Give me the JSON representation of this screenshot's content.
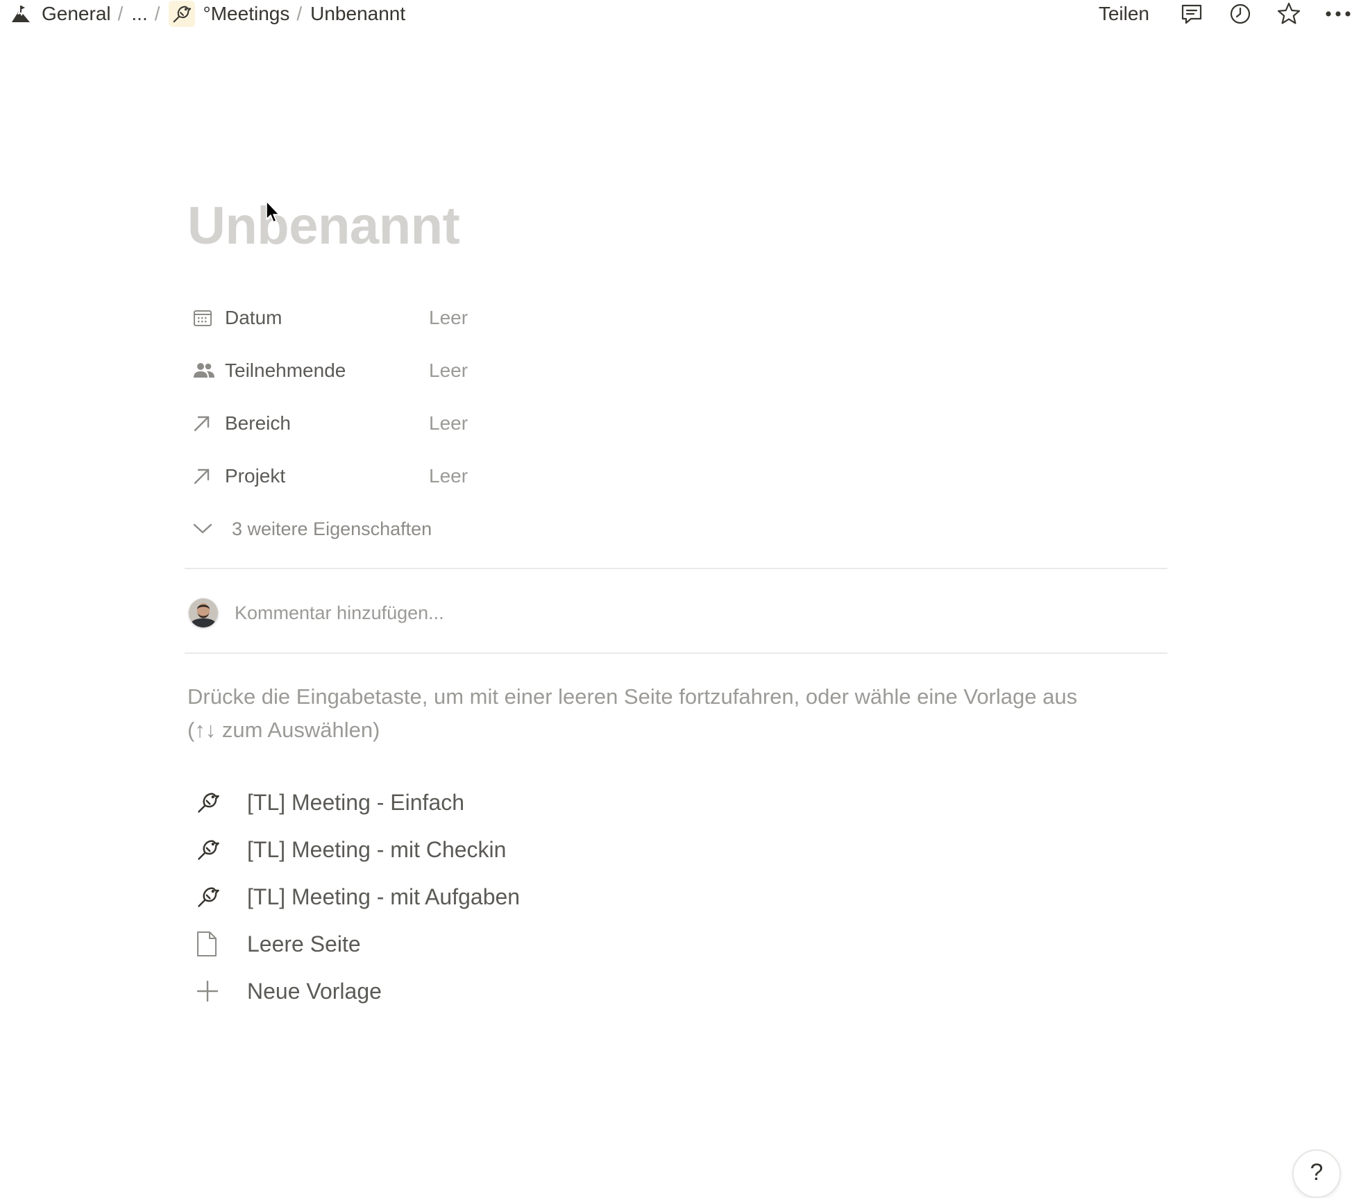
{
  "breadcrumb": {
    "items": [
      {
        "label": "General",
        "icon": "workspace-logo-icon"
      },
      {
        "label": "..."
      },
      {
        "label": "°Meetings",
        "icon": "bird-icon"
      },
      {
        "label": "Unbenannt"
      }
    ],
    "separator": "/"
  },
  "topbar": {
    "share_label": "Teilen",
    "icons": [
      "comment-icon",
      "clock-history-icon",
      "star-icon",
      "more-options-icon"
    ]
  },
  "page": {
    "title_placeholder": "Unbenannt"
  },
  "properties": [
    {
      "icon": "calendar-icon",
      "label": "Datum",
      "value": "Leer"
    },
    {
      "icon": "people-icon",
      "label": "Teilnehmende",
      "value": "Leer"
    },
    {
      "icon": "relation-arrow-icon",
      "label": "Bereich",
      "value": "Leer"
    },
    {
      "icon": "relation-arrow-icon",
      "label": "Projekt",
      "value": "Leer"
    }
  ],
  "more_properties_label": "3 weitere Eigenschaften",
  "comment": {
    "placeholder": "Kommentar hinzufügen..."
  },
  "template_hint": {
    "line1": "Drücke die Eingabetaste, um mit einer leeren Seite fortzufahren, oder wähle eine Vorlage aus",
    "line2": "(↑↓ zum Auswählen)"
  },
  "templates": [
    {
      "icon": "bird-icon",
      "label": "[TL] Meeting - Einfach"
    },
    {
      "icon": "bird-icon",
      "label": "[TL] Meeting - mit Checkin"
    },
    {
      "icon": "bird-icon",
      "label": "[TL] Meeting - mit Aufgaben"
    },
    {
      "icon": "page-icon",
      "label": "Leere Seite"
    },
    {
      "icon": "plus-icon",
      "label": "Neue Vorlage"
    }
  ],
  "help_label": "?",
  "colors": {
    "text": "#37352f",
    "muted": "#9b9a97",
    "title_placeholder": "#d3d2cf",
    "divider": "#e9e9e7",
    "bird_tag_bg": "#fbf3db"
  }
}
